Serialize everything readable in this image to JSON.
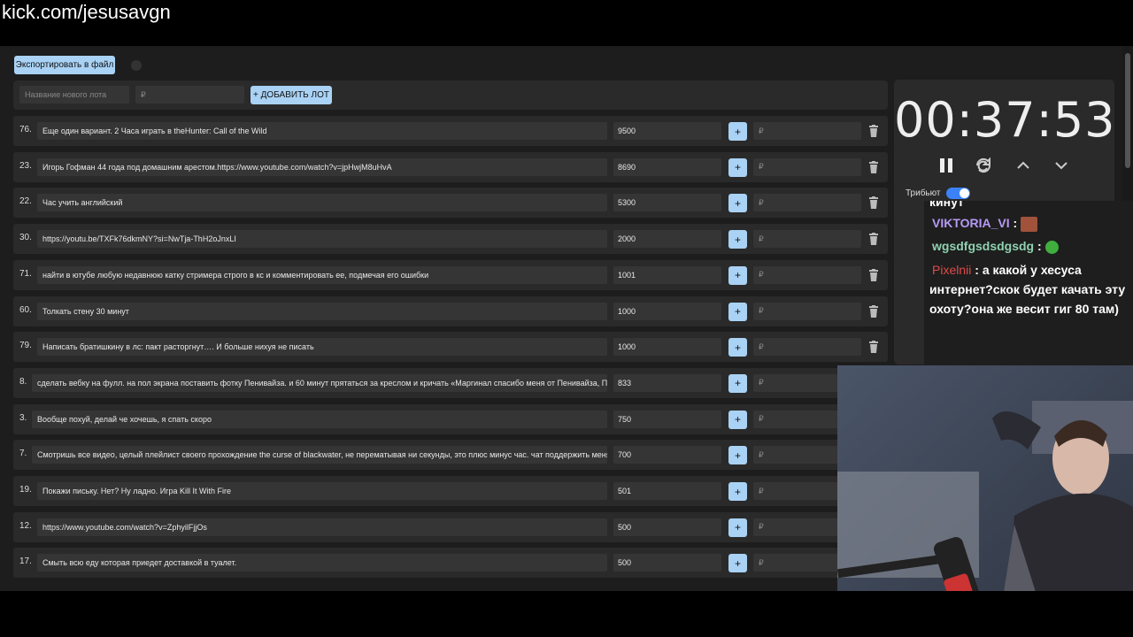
{
  "url": "kick.com/jesusavgn",
  "toolbar": {
    "export_label": "Экспортировать в файл"
  },
  "new_lot": {
    "name_placeholder": "Название нового лота",
    "amount_placeholder": "₽",
    "add_label": "+ ДОБАВИТЬ ЛОТ"
  },
  "lots": [
    {
      "num": "76.",
      "name": "Еще один вариант. 2 Часа играть в theHunter: Call of the Wild",
      "amount": "9500"
    },
    {
      "num": "23.",
      "name": "Игорь Гофман 44 года под домашним арестом.https://www.youtube.com/watch?v=jpHwjM8uHvA",
      "amount": "8690"
    },
    {
      "num": "22.",
      "name": "Час учить английский",
      "amount": "5300"
    },
    {
      "num": "30.",
      "name": "https://youtu.be/TXFk76dkmNY?si=NwTja-ThH2oJnxLI",
      "amount": "2000"
    },
    {
      "num": "71.",
      "name": "найти в ютубе любую недавнюю катку стримера строго в кс и комментировать ее, подмечая его ошибки",
      "amount": "1001"
    },
    {
      "num": "60.",
      "name": "Толкать стену 30 минут",
      "amount": "1000"
    },
    {
      "num": "79.",
      "name": "Написать братишкину в лс: пакт расторгнут…. И больше нихуя не писать",
      "amount": "1000"
    },
    {
      "num": "8.",
      "name": "сделать вебку на фулл. на пол экрана поставить фотку Пенивайза. и 60 минут прятаться за креслом и кричать «Маргинал спасибо меня от Пенивайза, Пе",
      "amount": "833"
    },
    {
      "num": "3.",
      "name": "Вообще похуй, делай че хочешь, я спать скоро",
      "amount": "750"
    },
    {
      "num": "7.",
      "name": "Смотришь все видео, целый плейлист своего прохождение the curse of blackwater, не перематывая ни секунды, это плюс минус час. чат поддержить меня",
      "amount": "700"
    },
    {
      "num": "19.",
      "name": "Покажи письку. Нет? Ну ладно. Игра Kill It With Fire",
      "amount": "501"
    },
    {
      "num": "12.",
      "name": "https://www.youtube.com/watch?v=ZphyilFjjOs",
      "amount": "500"
    },
    {
      "num": "17.",
      "name": "Смыть всю еду которая приедет доставкой в туалет.",
      "amount": "500"
    }
  ],
  "lot_add_placeholder": "₽",
  "timer": {
    "display": "00:37:53",
    "tribute_label": "Трибьют",
    "tribute_enabled": true
  },
  "chat": {
    "partial_top": "кинут",
    "messages": [
      {
        "user": "VIKTORIA_VI",
        "sep": " :",
        "emote": "emote-face"
      },
      {
        "user": "wgsdfgsdsdgsdg",
        "sep": " :",
        "emote": "emote-green"
      },
      {
        "user": "Pixelnii",
        "sep": " : ",
        "text": "а какой у хесуса",
        "line2": "интернет?скок будет качать эту",
        "line3": "охоту?она же весит гиг 80 там)"
      }
    ]
  },
  "colors": {
    "accent": "#a9d2f5",
    "toggle": "#3b82f6",
    "panel": "#2a2a2a",
    "bg": "#1d1d1d"
  },
  "icons": [
    "trash-icon",
    "pause-icon",
    "reset-icon",
    "chevron-up-icon",
    "chevron-down-icon"
  ]
}
